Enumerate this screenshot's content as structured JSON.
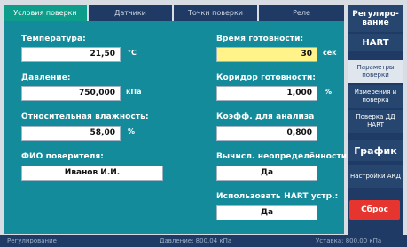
{
  "tabs": [
    "Условия поверки",
    "Датчики",
    "Точки поверки",
    "Реле"
  ],
  "fields": {
    "temperature_label": "Температура:",
    "temperature_value": "21,50",
    "temperature_unit": "°C",
    "pressure_label": "Давление:",
    "pressure_value": "750,000",
    "pressure_unit": "кПа",
    "humidity_label": "Относительная влажность:",
    "humidity_value": "58,00",
    "humidity_unit": "%",
    "verifier_label": "ФИО поверителя:",
    "verifier_value": "Иванов И.И.",
    "ready_time_label": "Время готовности:",
    "ready_time_value": "30",
    "ready_time_unit": "сек",
    "corridor_label": "Коридор готовности:",
    "corridor_value": "1,000",
    "corridor_unit": "%",
    "coef_label": "Коэфф. для анализа",
    "coef_value": "0,800",
    "calc_label": "Вычисл. неопределённости:",
    "calc_value": "Да",
    "hart_label": "Использовать HART устр.:",
    "hart_value": "Да"
  },
  "sidebar": {
    "regulation": "Регулиро-вание",
    "hart": "HART",
    "params": "Параметры поверки",
    "measure": "Измерения и поверка",
    "verify_dd": "Поверка ДД HART",
    "graph": "График",
    "settings": "Настройки АКД",
    "reset": "Сброс"
  },
  "status": {
    "left": "Регулирование",
    "middle": "Давление: 800.04 кПа",
    "right": "Уставка: 800.00 кПа"
  }
}
